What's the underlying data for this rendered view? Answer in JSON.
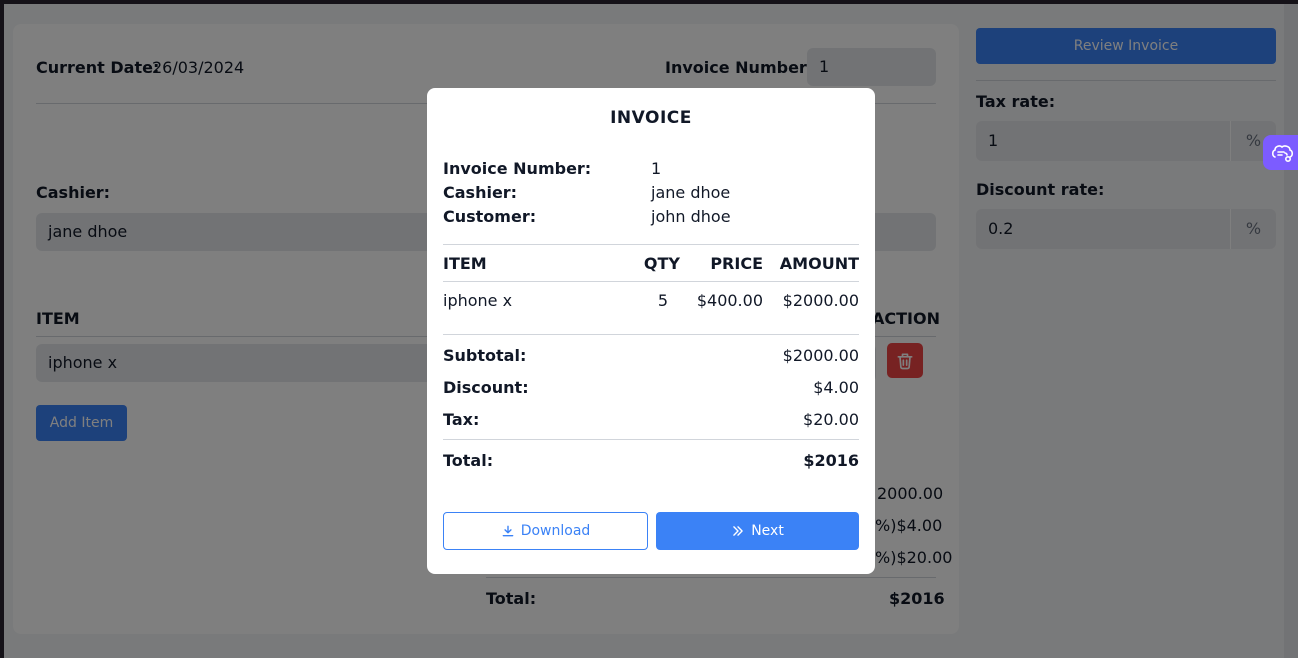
{
  "form": {
    "current_date_label": "Current Date:",
    "current_date": "26/03/2024",
    "invoice_number_label": "Invoice Number:",
    "invoice_number": "1",
    "cashier_label": "Cashier:",
    "cashier": "jane dhoe",
    "item_header": "ITEM",
    "action_header": "ACTION",
    "item_name": "iphone x",
    "add_item_label": "Add Item",
    "subtotal_value_partial": "2000.00",
    "discount_value_partial": "%)$4.00",
    "tax_value_partial": "%)$20.00",
    "total_label": "Total:",
    "total_value": "$2016"
  },
  "sidebar": {
    "review_button_label": "Review Invoice",
    "tax_rate_label": "Tax rate:",
    "tax_rate_value": "1",
    "discount_rate_label": "Discount rate:",
    "discount_rate_value": "0.2",
    "percent_symbol": "%"
  },
  "modal": {
    "title": "INVOICE",
    "invoice_number_label": "Invoice Number:",
    "invoice_number": "1",
    "cashier_label": "Cashier:",
    "cashier": "jane dhoe",
    "customer_label": "Customer:",
    "customer": "john dhoe",
    "columns": [
      "ITEM",
      "QTY",
      "PRICE",
      "AMOUNT"
    ],
    "items": [
      {
        "item": "iphone x",
        "qty": "5",
        "price": "$400.00",
        "amount": "$2000.00"
      }
    ],
    "subtotal_label": "Subtotal:",
    "subtotal": "$2000.00",
    "discount_label": "Discount:",
    "discount": "$4.00",
    "tax_label": "Tax:",
    "tax": "$20.00",
    "total_label": "Total:",
    "total": "$2016",
    "download_label": "Download",
    "next_label": "Next"
  },
  "colors": {
    "accent": "#3b82f6",
    "danger": "#ef4444",
    "extension": "#7c5cff"
  },
  "icons": {
    "trash": "trash-icon",
    "download": "download-icon",
    "next": "double-chevron-right-icon",
    "extension": "brain-icon"
  }
}
